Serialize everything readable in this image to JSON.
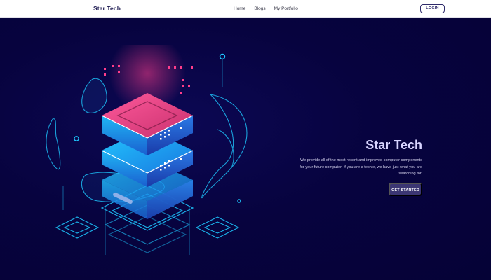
{
  "navbar": {
    "brand": "Star Tech",
    "links": [
      "Home",
      "Blogs",
      "My Portfolio"
    ],
    "login_label": "LOGIN"
  },
  "hero": {
    "title": "Star Tech",
    "description": "We provide all of the most recent and improved computer components for your future computer. If you are a techie, we have just what you are searching for.",
    "cta_label": "GET STARTED",
    "illustration": "isometric-server-stack-illustration"
  },
  "colors": {
    "navbar_bg": "#ffffff",
    "hero_bg": "#06023a",
    "title_color": "#d8d4ff",
    "cta_bg": "#3b3673",
    "neon_cyan": "#1ec8ff",
    "neon_pink": "#ff3d8b"
  }
}
